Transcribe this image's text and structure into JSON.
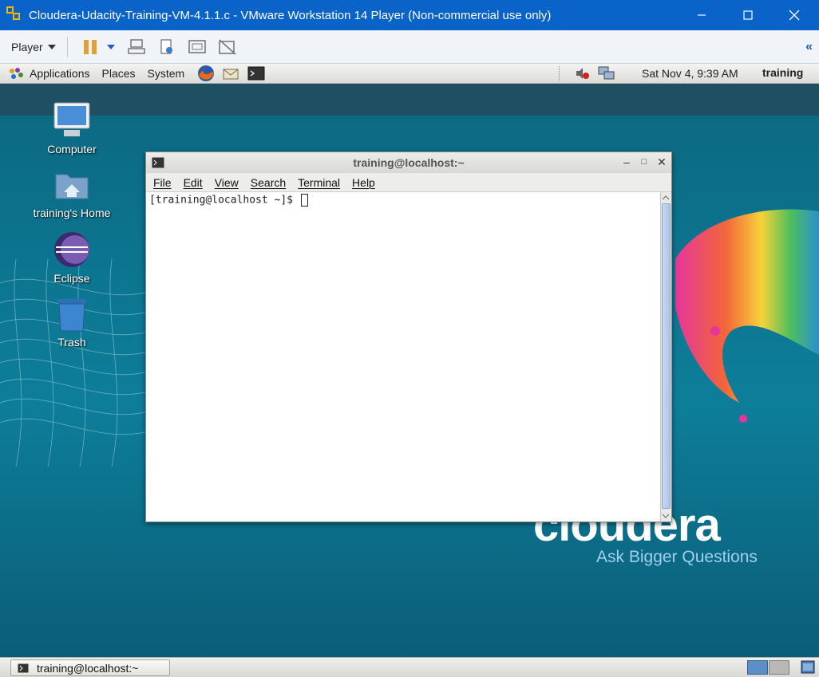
{
  "host_window": {
    "title": "Cloudera-Udacity-Training-VM-4.1.1.c - VMware Workstation 14 Player (Non-commercial use only)",
    "minimize_icon": "minimize-icon",
    "maximize_icon": "maximize-icon",
    "close_icon": "close-icon"
  },
  "vm_toolbar": {
    "player_label": "Player",
    "icons": [
      "pause-icon",
      "dropdown-arrow-icon",
      "send-ctrl-alt-del-icon",
      "removable-devices-icon",
      "fullscreen-icon",
      "unity-icon",
      "collapse-toolbar-icon"
    ]
  },
  "gnome_panel": {
    "menus": [
      "Applications",
      "Places",
      "System"
    ],
    "launchers": [
      "firefox-icon",
      "mail-icon",
      "terminal-icon"
    ],
    "clock": "Sat Nov  4,  9:39 AM",
    "user": "training",
    "tray_icons": [
      "volume-muted-icon",
      "network-icon"
    ]
  },
  "desktop": {
    "icons": [
      {
        "label": "Computer",
        "icon": "computer-icon"
      },
      {
        "label": "training's Home",
        "icon": "home-folder-icon"
      },
      {
        "label": "Eclipse",
        "icon": "eclipse-icon"
      },
      {
        "label": "Trash",
        "icon": "trash-icon"
      }
    ],
    "brand": "cloudera",
    "tagline": "Ask Bigger Questions"
  },
  "terminal": {
    "title": "training@localhost:~",
    "menus": [
      "File",
      "Edit",
      "View",
      "Search",
      "Terminal",
      "Help"
    ],
    "prompt": "[training@localhost ~]$ "
  },
  "bottom_panel": {
    "task": "training@localhost:~"
  },
  "colors": {
    "host_titlebar": "#0a63c9",
    "desktop_teal": "#0d7e9a",
    "tagline": "#9ed0ec"
  }
}
